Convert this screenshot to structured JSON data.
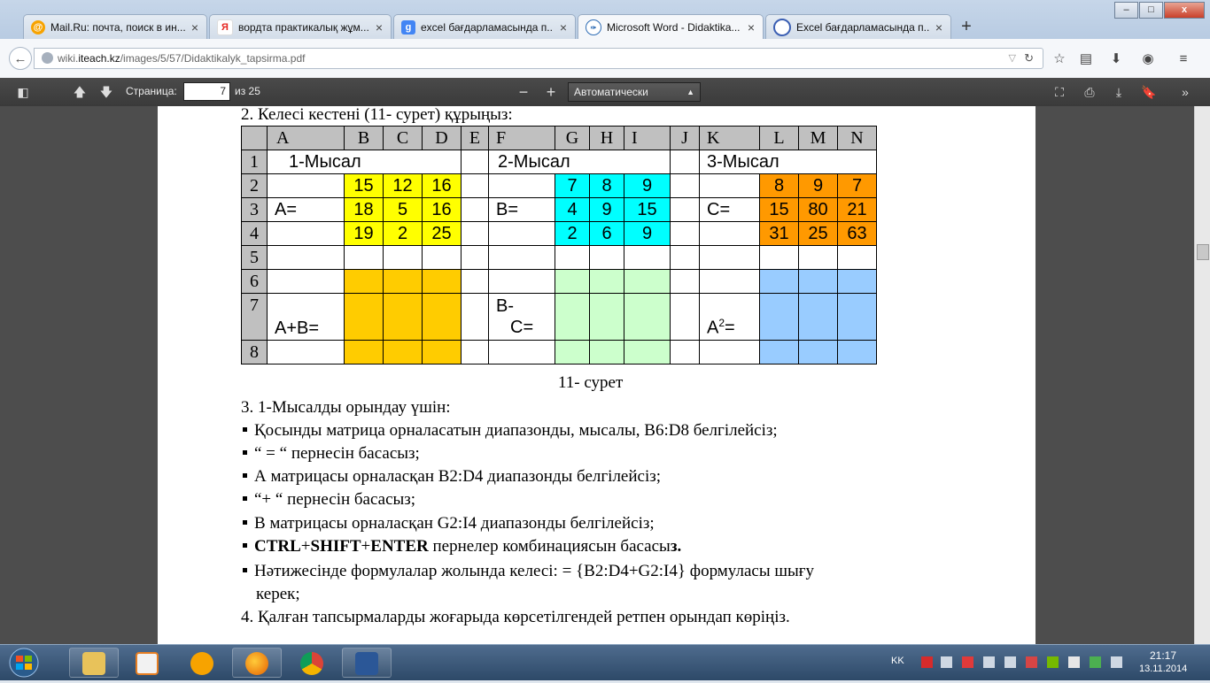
{
  "browser": {
    "tabs": [
      {
        "title": "Mail.Ru: почта, поиск в ин...",
        "icon": "mailru-icon",
        "color": "#f7a300",
        "glyph": "@"
      },
      {
        "title": "вордта практикалық жұм...",
        "icon": "yandex-icon",
        "color": "#e52620",
        "glyph": "Я"
      },
      {
        "title": "excel бағдарламасында п...",
        "icon": "google-icon",
        "color": "#4285f4",
        "glyph": "g"
      },
      {
        "title": "Microsoft Word - Didaktika...",
        "icon": "pdf-icon",
        "color": "#2f6db5",
        "glyph": "❧"
      },
      {
        "title": "Excel бағдарламасында п...",
        "icon": "site-icon",
        "color": "#3b5fb3",
        "glyph": "○"
      }
    ],
    "new_tab": "+",
    "window_buttons": {
      "minimize": "–",
      "maximize": "□",
      "close": "x"
    },
    "url_domain_prefix": "wiki.",
    "url_domain": "iteach.kz",
    "url_path": "/images/5/57/Didaktikalyk_tapsirma.pdf"
  },
  "pdf_toolbar": {
    "page_label": "Страница:",
    "page_current": "7",
    "page_total": "из 25",
    "zoom_out": "−",
    "zoom_in": "+",
    "zoom_value": "Автоматически"
  },
  "document": {
    "task2": "2. Келесі кестені (11- сурет) құрыңыз:",
    "table": {
      "col_headers": [
        "",
        "A",
        "B",
        "C",
        "D",
        "E",
        "F",
        "G",
        "H",
        "I",
        "J",
        "K",
        "L",
        "M",
        "N"
      ],
      "row_numbers": [
        "1",
        "2",
        "3",
        "4",
        "5",
        "6",
        "7",
        "8"
      ],
      "example1": "1-Мысал",
      "example2": "2-Мысал",
      "example3": "3-Мысал",
      "label_a": "A=",
      "label_b": "B=",
      "label_c": "C=",
      "matrix_a": [
        [
          "15",
          "12",
          "16"
        ],
        [
          "18",
          "5",
          "16"
        ],
        [
          "19",
          "2",
          "25"
        ]
      ],
      "matrix_b": [
        [
          "7",
          "8",
          "9"
        ],
        [
          "4",
          "9",
          "15"
        ],
        [
          "2",
          "6",
          "9"
        ]
      ],
      "matrix_c": [
        [
          "8",
          "9",
          "7"
        ],
        [
          "15",
          "80",
          "21"
        ],
        [
          "31",
          "25",
          "63"
        ]
      ],
      "sum_label": "A+B=",
      "diff_label_1": "B-",
      "diff_label_2": "C=",
      "square_label_base": "A",
      "square_label_exp": "2",
      "square_label_eq": "="
    },
    "caption": "11- сурет",
    "task3": "3. 1-Мысалды орындау үшін:",
    "bullets": [
      "Қосынды матрица орналасатын диапазонды, мысалы,  B6:D8 белгілейсіз;",
      "“ = “ пернесін  басасыз;",
      "А матрицасы орналасқан B2:D4  диапазонды белгілейсіз;",
      "“+ “ пернесін басасыз;",
      "В матрицасы орналасқан G2:I4  диапазонды белгілейсіз;"
    ],
    "bullet_bold": {
      "key1": "CTRL",
      "plus1": "+",
      "key2": "SHIFT",
      "plus2": "+",
      "key3": "ENTER",
      "rest": " пернелер комбинациясын басасы",
      "rest_bold": "з."
    },
    "bullet_result_line1": "Нәтижесінде формулалар жолында келесі: = {B2:D4+G2:I4} формуласы шығу",
    "bullet_result_line2": "керек;",
    "task4": "4. Қалған тапсырмаларды жоғарыда көрсетілгендей ретпен орындап көріңіз."
  },
  "taskbar": {
    "language": "KK",
    "time": "21:17",
    "date": "13.11.2014",
    "apps": [
      "explorer-icon",
      "media-player-icon",
      "mailru-agent-icon",
      "firefox-icon",
      "chrome-icon",
      "word-icon"
    ]
  },
  "colors": {
    "yellow": "#ffff00",
    "cyan": "#00ffff",
    "orange": "#ff9900",
    "gold": "#ffcc00",
    "light_green": "#ccffcc",
    "light_blue": "#99ccff",
    "header_gray": "#c0c0c0"
  }
}
